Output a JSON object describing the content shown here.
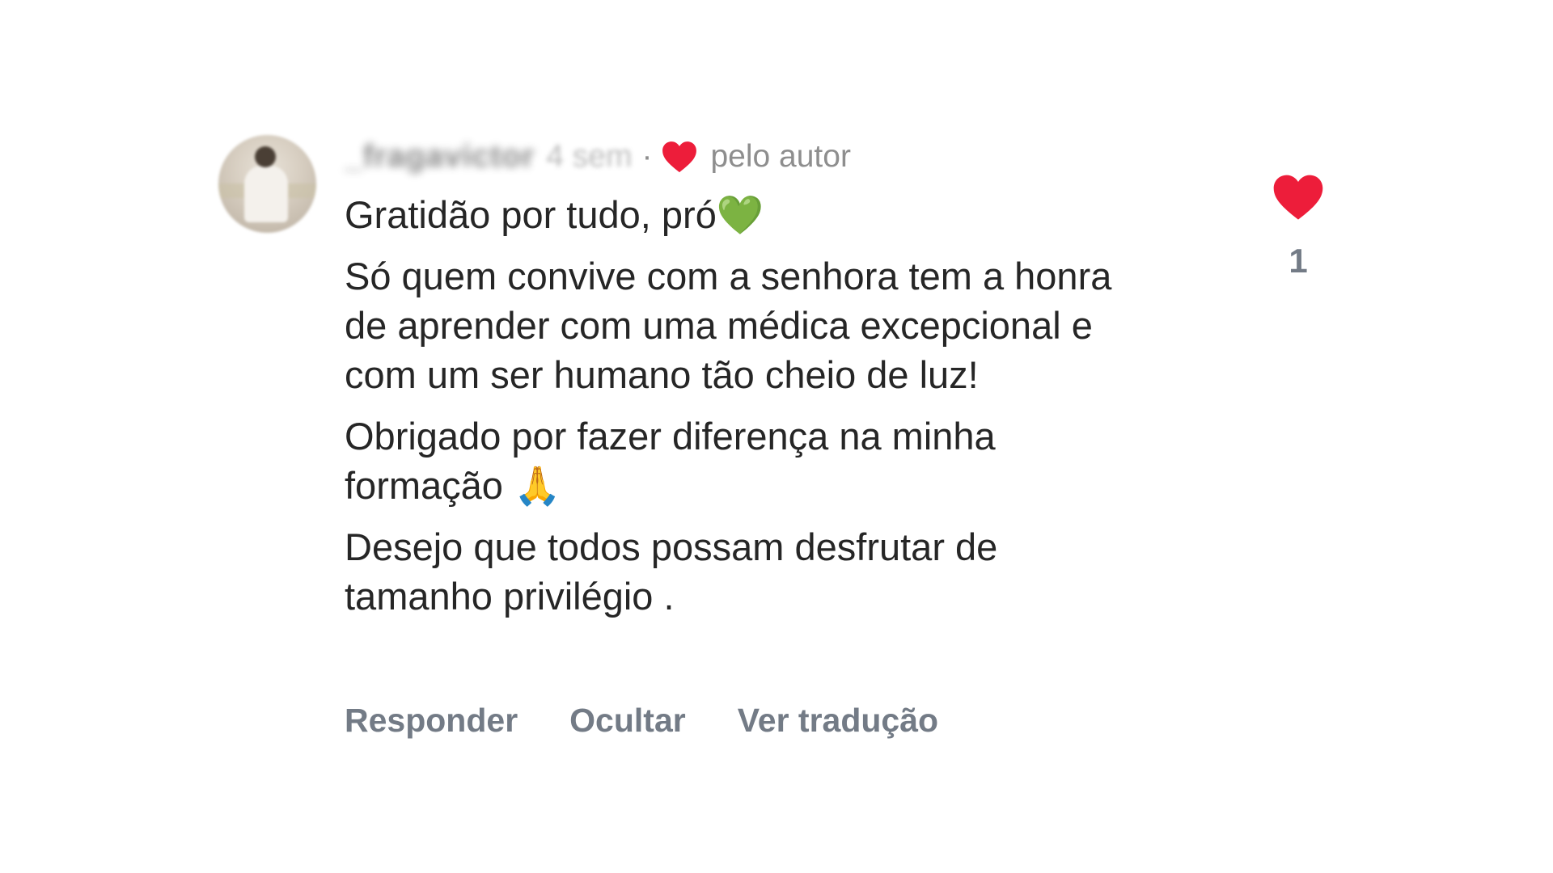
{
  "comment": {
    "username": "_fragavictor",
    "time": "4 sem",
    "separator": "·",
    "liked_by_author_label": "pelo autor",
    "paragraphs": [
      "Gratidão por tudo, pró💚",
      "Só quem convive com a senhora tem a honra de aprender com uma médica excepcional e com um ser humano tão cheio de luz!",
      "Obrigado por fazer diferença na minha formação 🙏",
      "Desejo que todos possam desfrutar de tamanho privilégio ."
    ],
    "actions": {
      "reply": "Responder",
      "hide": "Ocultar",
      "translate": "Ver tradução"
    },
    "like_count": "1"
  },
  "colors": {
    "heart": "#ed1d3a",
    "secondary_text": "#8e8e8e",
    "action_text": "#737b86",
    "primary_text": "#262626"
  },
  "icons": {
    "author_heart": "heart-icon",
    "like": "heart-icon",
    "avatar": "user-avatar"
  }
}
